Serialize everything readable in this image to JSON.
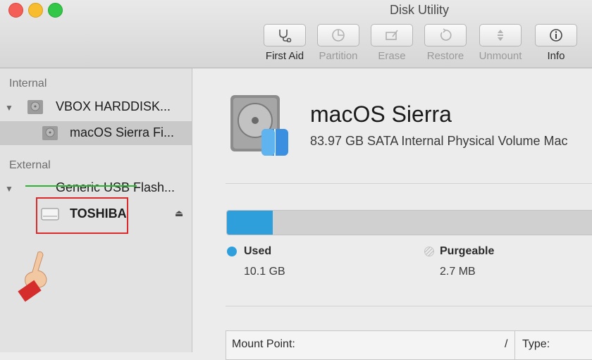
{
  "window": {
    "title": "Disk Utility"
  },
  "toolbar": {
    "first_aid": "First Aid",
    "partition": "Partition",
    "erase": "Erase",
    "restore": "Restore",
    "unmount": "Unmount",
    "info": "Info"
  },
  "sidebar": {
    "internal_header": "Internal",
    "external_header": "External",
    "internal_disk": "VBOX HARDDISK...",
    "internal_volume": "macOS Sierra Fi...",
    "external_disk": "Generic USB Flash...",
    "external_volume": "TOSHIBA"
  },
  "volume": {
    "name": "macOS Sierra",
    "description": "83.97 GB SATA Internal Physical Volume Mac",
    "used_fraction": 0.12
  },
  "legend": {
    "used_label": "Used",
    "used_value": "10.1 GB",
    "used_color": "#2f9fdc",
    "purgeable_label": "Purgeable",
    "purgeable_value": "2.7 MB"
  },
  "info_table": {
    "mount_point_label": "Mount Point:",
    "mount_point_value": "/",
    "type_label": "Type:"
  },
  "icons": {
    "first_aid": "stethoscope-icon",
    "partition": "pie-icon",
    "erase": "eraser-icon",
    "restore": "restore-arrow-icon",
    "unmount": "unmount-icon",
    "info": "info-icon"
  }
}
